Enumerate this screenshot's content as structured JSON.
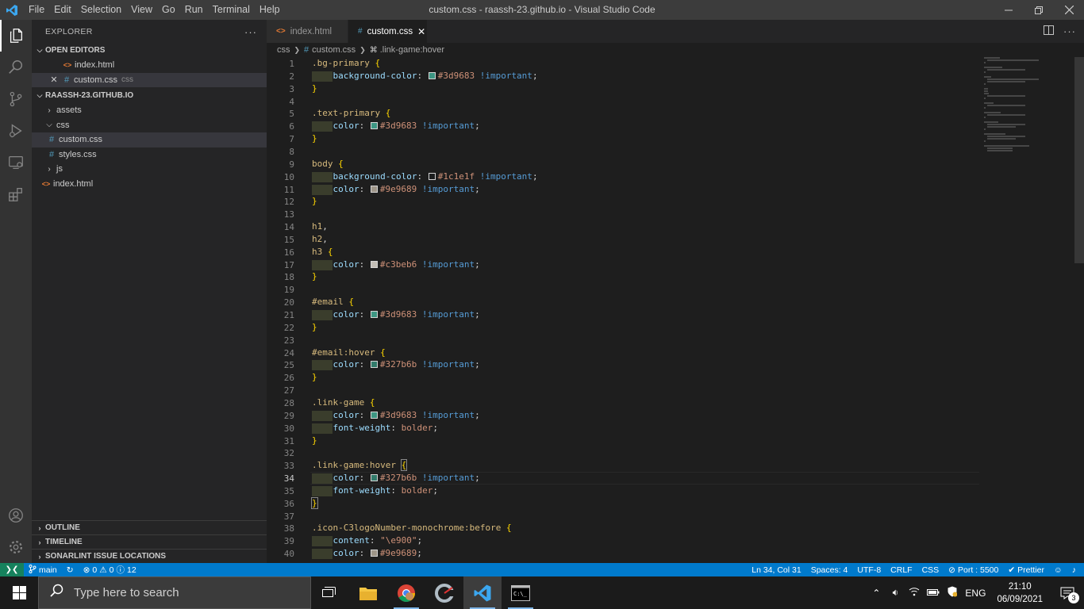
{
  "window": {
    "title": "custom.css - raassh-23.github.io - Visual Studio Code",
    "menu": [
      "File",
      "Edit",
      "Selection",
      "View",
      "Go",
      "Run",
      "Terminal",
      "Help"
    ]
  },
  "sidebar": {
    "header": "EXPLORER",
    "open_editors_label": "OPEN EDITORS",
    "open_editors": [
      {
        "name": "index.html",
        "desc": "",
        "type": "html"
      },
      {
        "name": "custom.css",
        "desc": "css",
        "type": "css"
      }
    ],
    "project_label": "RAASSH-23.GITHUB.IO",
    "tree": [
      {
        "name": "assets",
        "kind": "folder-closed"
      },
      {
        "name": "css",
        "kind": "folder-open"
      },
      {
        "name": "custom.css",
        "kind": "css"
      },
      {
        "name": "styles.css",
        "kind": "css"
      },
      {
        "name": "js",
        "kind": "folder-closed"
      },
      {
        "name": "index.html",
        "kind": "html"
      }
    ],
    "bottom_sections": [
      "OUTLINE",
      "TIMELINE",
      "SONARLINT ISSUE LOCATIONS"
    ]
  },
  "tabs": [
    {
      "label": "index.html",
      "active": false
    },
    {
      "label": "custom.css",
      "active": true
    }
  ],
  "breadcrumb": {
    "folder": "css",
    "file": "custom.css",
    "symbol": ".link-game:hover"
  },
  "editor": {
    "current_line": 34,
    "lines": [
      {
        "n": "1",
        "seg": [
          [
            "sel",
            ".bg-primary "
          ],
          [
            "br",
            "{"
          ]
        ]
      },
      {
        "n": "2",
        "indent": true,
        "seg": [
          [
            "prop",
            "background-color"
          ],
          [
            "p",
            ": "
          ],
          [
            "sw",
            "#3d9683"
          ],
          [
            "val",
            "#3d9683"
          ],
          [
            "p",
            " "
          ],
          [
            "imp",
            "!important"
          ],
          [
            "p",
            ";"
          ]
        ]
      },
      {
        "n": "3",
        "seg": [
          [
            "br",
            "}"
          ]
        ]
      },
      {
        "n": "4",
        "seg": []
      },
      {
        "n": "5",
        "seg": [
          [
            "sel",
            ".text-primary "
          ],
          [
            "br",
            "{"
          ]
        ]
      },
      {
        "n": "6",
        "indent": true,
        "seg": [
          [
            "prop",
            "color"
          ],
          [
            "p",
            ": "
          ],
          [
            "sw",
            "#3d9683"
          ],
          [
            "val",
            "#3d9683"
          ],
          [
            "p",
            " "
          ],
          [
            "imp",
            "!important"
          ],
          [
            "p",
            ";"
          ]
        ]
      },
      {
        "n": "7",
        "seg": [
          [
            "br",
            "}"
          ]
        ]
      },
      {
        "n": "8",
        "seg": []
      },
      {
        "n": "9",
        "seg": [
          [
            "sel",
            "body "
          ],
          [
            "br",
            "{"
          ]
        ]
      },
      {
        "n": "10",
        "indent": true,
        "seg": [
          [
            "prop",
            "background-color"
          ],
          [
            "p",
            ": "
          ],
          [
            "sw",
            "#1c1e1f"
          ],
          [
            "val",
            "#1c1e1f"
          ],
          [
            "p",
            " "
          ],
          [
            "imp",
            "!important"
          ],
          [
            "p",
            ";"
          ]
        ]
      },
      {
        "n": "11",
        "indent": true,
        "seg": [
          [
            "prop",
            "color"
          ],
          [
            "p",
            ": "
          ],
          [
            "sw",
            "#9e9689"
          ],
          [
            "val",
            "#9e9689"
          ],
          [
            "p",
            " "
          ],
          [
            "imp",
            "!important"
          ],
          [
            "p",
            ";"
          ]
        ]
      },
      {
        "n": "12",
        "seg": [
          [
            "br",
            "}"
          ]
        ]
      },
      {
        "n": "13",
        "seg": []
      },
      {
        "n": "14",
        "seg": [
          [
            "sel",
            "h1"
          ],
          [
            "p",
            ","
          ]
        ]
      },
      {
        "n": "15",
        "seg": [
          [
            "sel",
            "h2"
          ],
          [
            "p",
            ","
          ]
        ]
      },
      {
        "n": "16",
        "seg": [
          [
            "sel",
            "h3 "
          ],
          [
            "br",
            "{"
          ]
        ]
      },
      {
        "n": "17",
        "indent": true,
        "seg": [
          [
            "prop",
            "color"
          ],
          [
            "p",
            ": "
          ],
          [
            "sw",
            "#c3beb6"
          ],
          [
            "val",
            "#c3beb6"
          ],
          [
            "p",
            " "
          ],
          [
            "imp",
            "!important"
          ],
          [
            "p",
            ";"
          ]
        ]
      },
      {
        "n": "18",
        "seg": [
          [
            "br",
            "}"
          ]
        ]
      },
      {
        "n": "19",
        "seg": []
      },
      {
        "n": "20",
        "seg": [
          [
            "sel",
            "#email "
          ],
          [
            "br",
            "{"
          ]
        ]
      },
      {
        "n": "21",
        "indent": true,
        "seg": [
          [
            "prop",
            "color"
          ],
          [
            "p",
            ": "
          ],
          [
            "sw",
            "#3d9683"
          ],
          [
            "val",
            "#3d9683"
          ],
          [
            "p",
            " "
          ],
          [
            "imp",
            "!important"
          ],
          [
            "p",
            ";"
          ]
        ]
      },
      {
        "n": "22",
        "seg": [
          [
            "br",
            "}"
          ]
        ]
      },
      {
        "n": "23",
        "seg": []
      },
      {
        "n": "24",
        "seg": [
          [
            "sel",
            "#email:hover "
          ],
          [
            "br",
            "{"
          ]
        ]
      },
      {
        "n": "25",
        "indent": true,
        "seg": [
          [
            "prop",
            "color"
          ],
          [
            "p",
            ": "
          ],
          [
            "sw",
            "#327b6b"
          ],
          [
            "val",
            "#327b6b"
          ],
          [
            "p",
            " "
          ],
          [
            "imp",
            "!important"
          ],
          [
            "p",
            ";"
          ]
        ]
      },
      {
        "n": "26",
        "seg": [
          [
            "br",
            "}"
          ]
        ]
      },
      {
        "n": "27",
        "seg": []
      },
      {
        "n": "28",
        "seg": [
          [
            "sel",
            ".link-game "
          ],
          [
            "br",
            "{"
          ]
        ]
      },
      {
        "n": "29",
        "indent": true,
        "seg": [
          [
            "prop",
            "color"
          ],
          [
            "p",
            ": "
          ],
          [
            "sw",
            "#3d9683"
          ],
          [
            "val",
            "#3d9683"
          ],
          [
            "p",
            " "
          ],
          [
            "imp",
            "!important"
          ],
          [
            "p",
            ";"
          ]
        ]
      },
      {
        "n": "30",
        "indent": true,
        "seg": [
          [
            "prop",
            "font-weight"
          ],
          [
            "p",
            ": "
          ],
          [
            "val",
            "bolder"
          ],
          [
            "p",
            ";"
          ]
        ]
      },
      {
        "n": "31",
        "seg": [
          [
            "br",
            "}"
          ]
        ]
      },
      {
        "n": "32",
        "seg": []
      },
      {
        "n": "33",
        "seg": [
          [
            "sel",
            ".link-game:hover "
          ],
          [
            "br2",
            "{"
          ]
        ]
      },
      {
        "n": "34",
        "indent": true,
        "seg": [
          [
            "prop",
            "color"
          ],
          [
            "p",
            ": "
          ],
          [
            "sw",
            "#327b6b"
          ],
          [
            "val",
            "#327b6b"
          ],
          [
            "p",
            " "
          ],
          [
            "imp",
            "!important"
          ],
          [
            "p",
            ";"
          ]
        ]
      },
      {
        "n": "35",
        "indent": true,
        "seg": [
          [
            "prop",
            "font-weight"
          ],
          [
            "p",
            ": "
          ],
          [
            "val",
            "bolder"
          ],
          [
            "p",
            ";"
          ]
        ]
      },
      {
        "n": "36",
        "seg": [
          [
            "br2",
            "}"
          ]
        ]
      },
      {
        "n": "37",
        "seg": []
      },
      {
        "n": "38",
        "seg": [
          [
            "sel",
            ".icon-C3logoNumber-monochrome:before "
          ],
          [
            "br",
            "{"
          ]
        ]
      },
      {
        "n": "39",
        "indent": true,
        "seg": [
          [
            "prop",
            "content"
          ],
          [
            "p",
            ": "
          ],
          [
            "val",
            "\"\\e900\""
          ],
          [
            "p",
            ";"
          ]
        ]
      },
      {
        "n": "40",
        "indent": true,
        "seg": [
          [
            "prop",
            "color"
          ],
          [
            "p",
            ": "
          ],
          [
            "sw",
            "#9e9689"
          ],
          [
            "val",
            "#9e9689"
          ],
          [
            "p",
            ";"
          ]
        ]
      }
    ]
  },
  "statusbar": {
    "branch": "main",
    "errors": "0",
    "warnings": "0",
    "infos": "12",
    "position": "Ln 34, Col 31",
    "spaces": "Spaces: 4",
    "encoding": "UTF-8",
    "eol": "CRLF",
    "language": "CSS",
    "port": "Port : 5500",
    "formatter": "Prettier"
  },
  "taskbar": {
    "search_placeholder": "Type here to search",
    "language": "ENG",
    "time": "21:10",
    "date": "06/09/2021",
    "notifications": "3"
  },
  "colors": {
    "accent": "#007acc",
    "remote": "#16825d",
    "titlebar": "#3c3c3c",
    "sidebar": "#252526",
    "editor": "#1e1e1e"
  }
}
